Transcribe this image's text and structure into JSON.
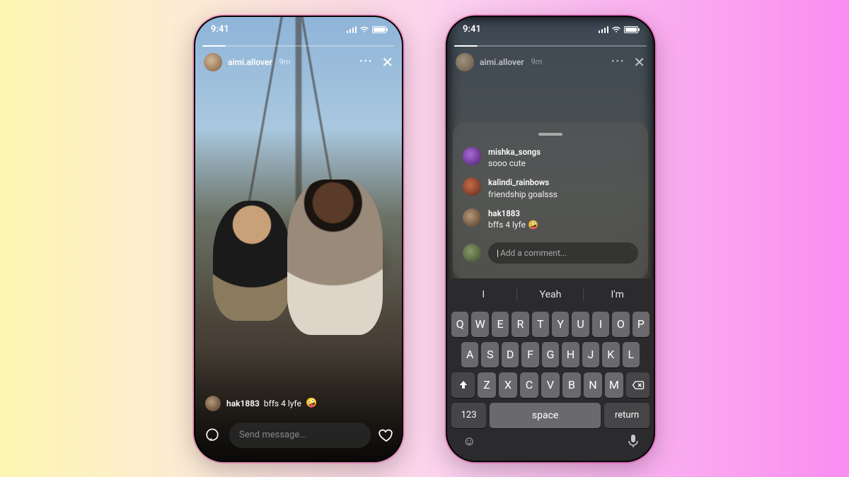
{
  "status": {
    "time": "9:41"
  },
  "story": {
    "username": "aimi.allover",
    "age": "9m"
  },
  "pinned_comment": {
    "username": "hak1883",
    "text": "bffs 4 lyfe",
    "emoji": "🤪"
  },
  "send_placeholder": "Send message...",
  "comments_sheet": {
    "items": [
      {
        "username": "mishka_songs",
        "text": "sooo cute"
      },
      {
        "username": "kalindi_rainbows",
        "text": "friendship goalsss"
      },
      {
        "username": "hak1883",
        "text": "bffs 4 lyfe 🤪"
      }
    ],
    "add_placeholder": "Add a comment..."
  },
  "keyboard": {
    "suggestions": [
      "I",
      "Yeah",
      "I'm"
    ],
    "row1": [
      "Q",
      "W",
      "E",
      "R",
      "T",
      "Y",
      "U",
      "I",
      "O",
      "P"
    ],
    "row2": [
      "A",
      "S",
      "D",
      "F",
      "G",
      "H",
      "J",
      "K",
      "L"
    ],
    "row3": [
      "Z",
      "X",
      "C",
      "V",
      "B",
      "N",
      "M"
    ],
    "num_label": "123",
    "space_label": "space",
    "return_label": "return"
  }
}
